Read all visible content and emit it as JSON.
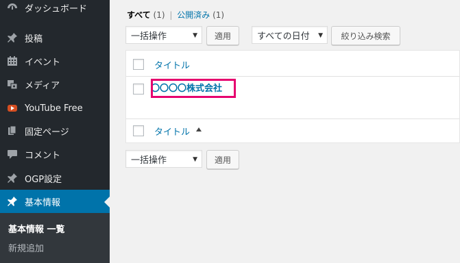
{
  "sidebar": {
    "items": [
      {
        "label": "ダッシュボード",
        "icon": "dashboard-icon"
      },
      {
        "label": "投稿",
        "icon": "pin-icon"
      },
      {
        "label": "イベント",
        "icon": "calendar-icon"
      },
      {
        "label": "メディア",
        "icon": "media-icon"
      },
      {
        "label": "YouTube Free",
        "icon": "youtube-icon"
      },
      {
        "label": "固定ページ",
        "icon": "pages-icon"
      },
      {
        "label": "コメント",
        "icon": "comment-icon"
      },
      {
        "label": "OGP設定",
        "icon": "pin-icon"
      },
      {
        "label": "基本情報",
        "icon": "pin-icon"
      }
    ],
    "submenu": {
      "current": "基本情報 一覧",
      "add_new": "新規追加"
    }
  },
  "filters": {
    "all_label": "すべて",
    "all_count": "(1)",
    "separator": "|",
    "published_label": "公開済み",
    "published_count": "(1)"
  },
  "top_actions": {
    "bulk_select": "一括操作",
    "apply_button": "適用",
    "date_select": "すべての日付",
    "filter_button": "絞り込み検索"
  },
  "table": {
    "header_column": "タイトル",
    "footer_column": "タイトル",
    "rows": [
      {
        "title": "〇〇〇〇株式会社"
      }
    ]
  },
  "bottom_actions": {
    "bulk_select": "一括操作",
    "apply_button": "適用"
  },
  "colors": {
    "sidebar_bg": "#23282d",
    "active_bg": "#0073aa",
    "link": "#0073aa",
    "highlight_border": "#e6006e"
  }
}
